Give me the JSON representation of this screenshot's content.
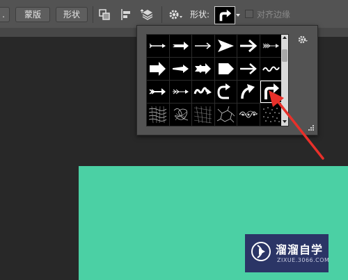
{
  "toolbar": {
    "partial_label": ".",
    "mask_label": "蒙版",
    "shape_button_label": "形状",
    "shape_label": "形状:",
    "align_edges_label": "对齐边缘",
    "align_edges_checked": false
  },
  "shape_picker": {
    "shapes": [
      {
        "icon": "arrow-thin-icon"
      },
      {
        "icon": "arrow-feathered-icon"
      },
      {
        "icon": "arrow-simple-icon"
      },
      {
        "icon": "arrow-triangle-icon"
      },
      {
        "icon": "arrow-bold-icon"
      },
      {
        "icon": "arrow-fletched-icon"
      },
      {
        "icon": "arrow-block-icon"
      },
      {
        "icon": "arrow-tapered-icon"
      },
      {
        "icon": "arrow-notched-icon"
      },
      {
        "icon": "arrow-pentagon-icon"
      },
      {
        "icon": "arrow-right-icon"
      },
      {
        "icon": "arrow-wave-icon"
      },
      {
        "icon": "arrow-barbed-icon"
      },
      {
        "icon": "arrow-dotted-icon"
      },
      {
        "icon": "arrow-squiggle-icon"
      },
      {
        "icon": "arrow-curve-back-icon"
      },
      {
        "icon": "arrow-curve-up-icon"
      },
      {
        "icon": "arrow-turn-right-icon"
      },
      {
        "icon": "texture-grid-icon"
      },
      {
        "icon": "texture-scribble-icon"
      },
      {
        "icon": "texture-mesh-icon"
      },
      {
        "icon": "texture-cracked-icon"
      },
      {
        "icon": "texture-lace-icon"
      },
      {
        "icon": "texture-dots-icon"
      }
    ],
    "selected_index": 17
  },
  "watermark": {
    "title": "溜溜自学",
    "subtitle": "ZIXUE.3066.COM"
  },
  "colors": {
    "toolbar_bg": "#535353",
    "canvas_bg": "#282828",
    "document_fill": "#4bd0a4",
    "annotation_arrow": "#e8302a",
    "watermark_bg": "#2b3566"
  }
}
